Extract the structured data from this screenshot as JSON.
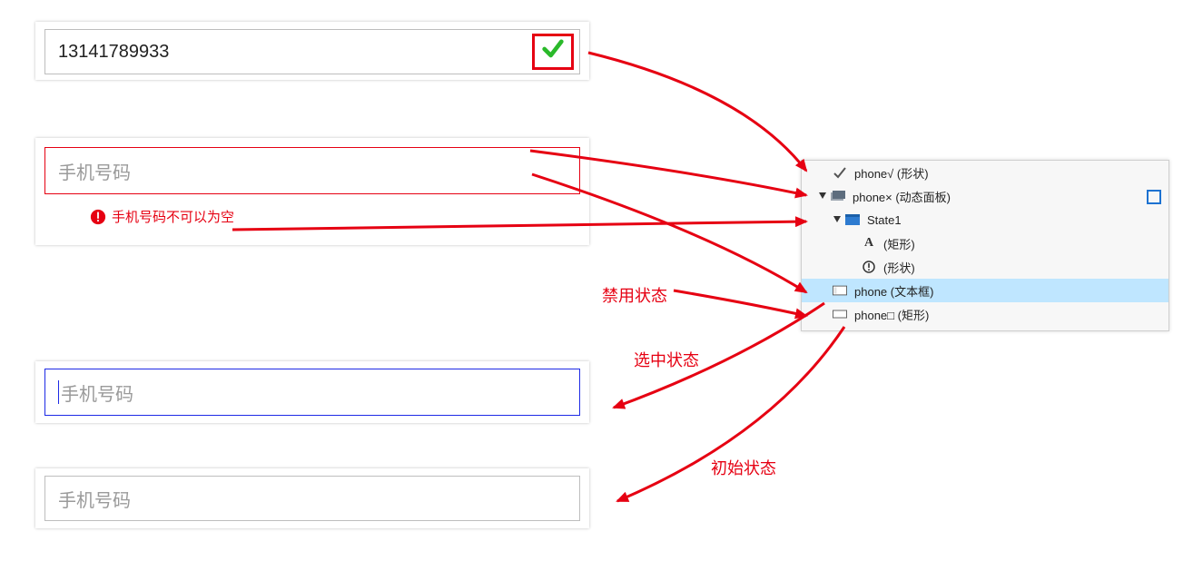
{
  "inputs": {
    "valid": {
      "value": "13141789933"
    },
    "error": {
      "placeholder": "手机号码",
      "message": "手机号码不可以为空"
    },
    "selected": {
      "placeholder": "手机号码"
    },
    "initial": {
      "placeholder": "手机号码"
    }
  },
  "annotations": {
    "disabled": "禁用状态",
    "selected": "选中状态",
    "initial": "初始状态"
  },
  "outline": {
    "rows": [
      {
        "label": "phone√ (形状)"
      },
      {
        "label": "phone× (动态面板)"
      },
      {
        "label": "State1"
      },
      {
        "label": "(矩形)"
      },
      {
        "label": "(形状)"
      },
      {
        "label": "phone (文本框)"
      },
      {
        "label": "phone□ (矩形)"
      }
    ]
  },
  "colors": {
    "error": "#e60012",
    "select_border": "#1d2ae6",
    "panel_bg": "#f7f7f7",
    "panel_selected": "#bfe6ff",
    "check_green": "#2ab92a"
  }
}
